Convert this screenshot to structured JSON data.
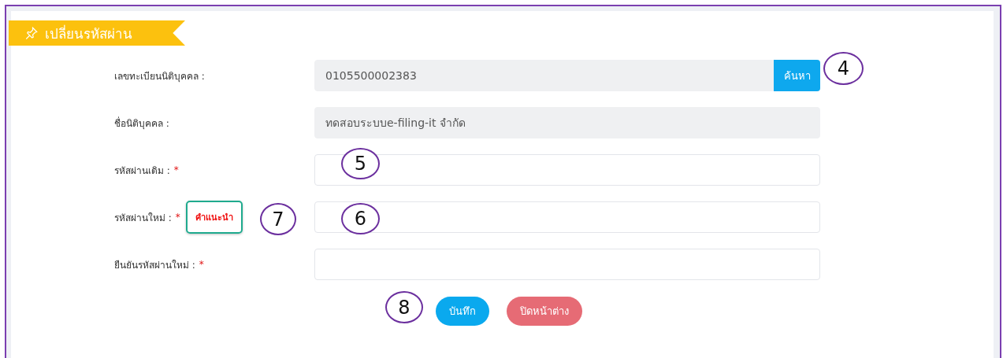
{
  "header": {
    "title": "เปลี่ยนรหัสผ่าน"
  },
  "fields": [
    {
      "label": "เลขทะเบียนนิติบุคคล :",
      "required": false,
      "value": "0105500002383",
      "readonly": true,
      "button": "ค้นหา"
    },
    {
      "label": "ชื่อนิติบุคคล :",
      "required": false,
      "value": "ทดสอบระบบe-filing-it จำกัด",
      "readonly": true
    },
    {
      "label": "รหัสผ่านเดิม :",
      "required": true,
      "readonly": false
    },
    {
      "label": "รหัสผ่านใหม่ :",
      "required": true,
      "readonly": false,
      "hint": "คำแนะนำ"
    },
    {
      "label": "ยืนยันรหัสผ่านใหม่ :",
      "required": true,
      "readonly": false
    }
  ],
  "required_mark": "*",
  "buttons": [
    {
      "label": "บันทึก",
      "kind": "primary"
    },
    {
      "label": "ปิดหน้าต่าง",
      "kind": "danger"
    }
  ],
  "annotations": [
    "4",
    "5",
    "6",
    "7",
    "8"
  ]
}
